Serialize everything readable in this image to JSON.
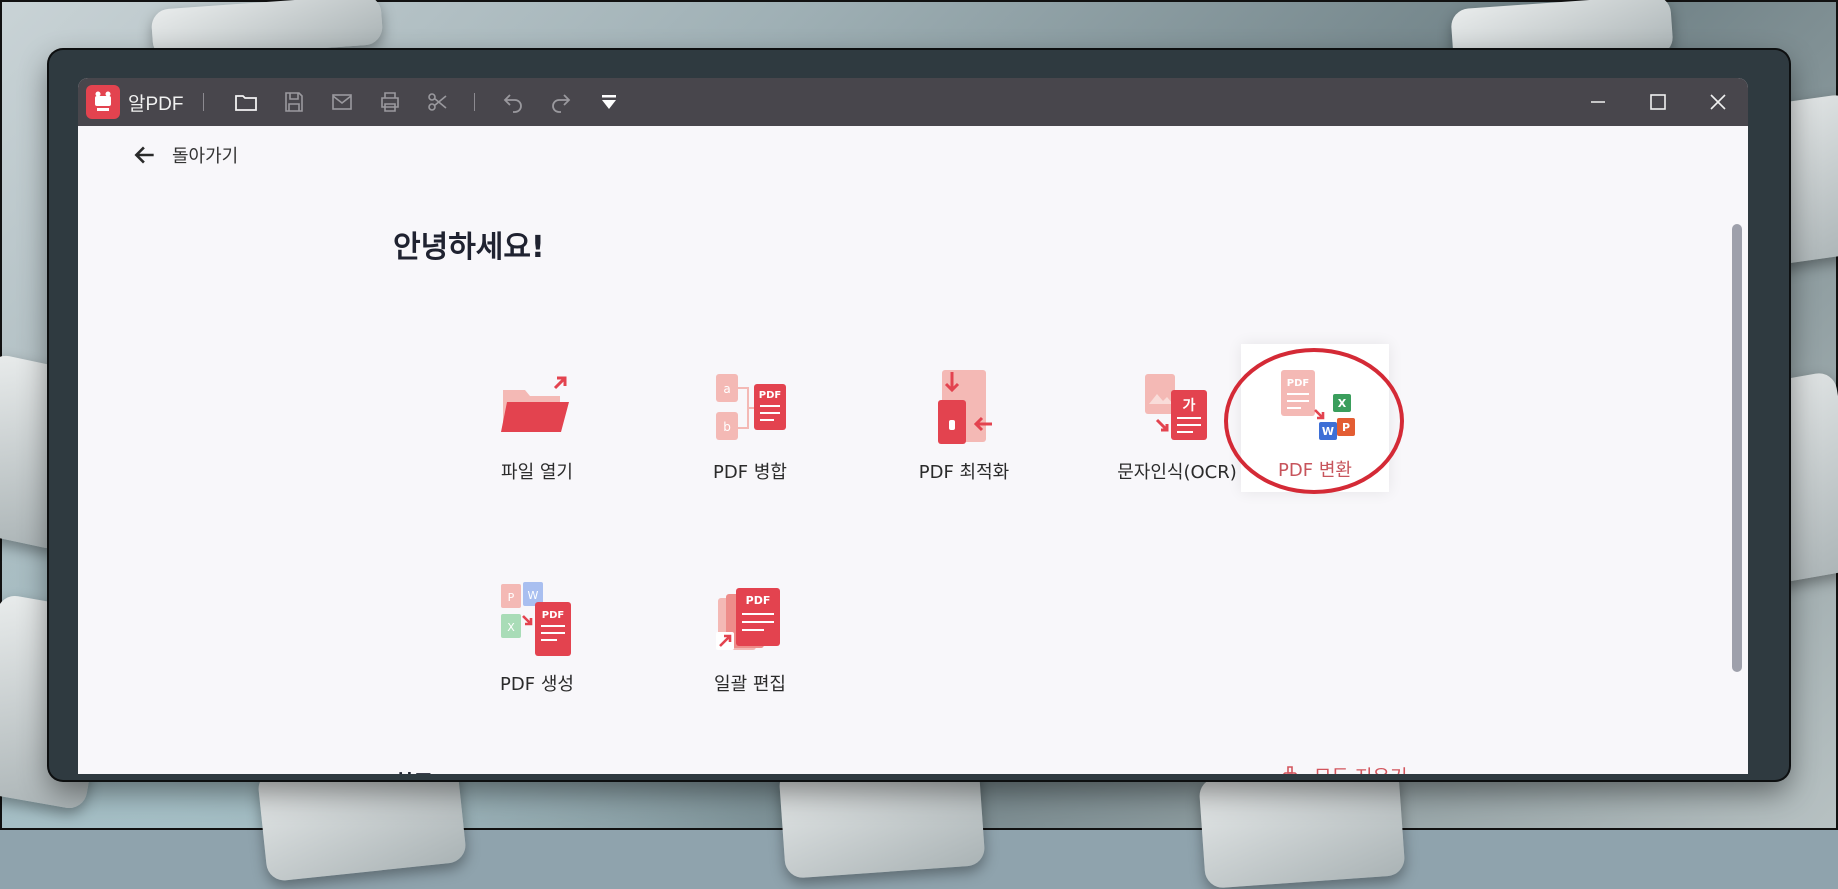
{
  "window": {
    "app_name": "알PDF",
    "toolbar": [
      "folder-icon",
      "save-icon",
      "mail-icon",
      "print-icon",
      "scissors-icon",
      "undo-icon",
      "redo-icon",
      "more-dropdown-icon"
    ]
  },
  "nav": {
    "back_label": "돌아가기"
  },
  "main": {
    "greeting": "안녕하세요!",
    "tiles": [
      {
        "label": "파일 열기"
      },
      {
        "label": "PDF 병합"
      },
      {
        "label": "PDF 최적화"
      },
      {
        "label": "문자인식(OCR)"
      },
      {
        "label": "PDF 변환",
        "selected": true
      },
      {
        "label": "PDF 생성"
      },
      {
        "label": "일괄 편집"
      }
    ],
    "recent_title": "최근",
    "clear_all_label": "모두 지우기"
  },
  "colors": {
    "accent": "#e3434f",
    "titlebar": "#48464c",
    "highlight": "#d42a36"
  },
  "icons": {
    "pdf_badge": "PDF",
    "ocr_badge": "가",
    "ocr_letter": "가"
  }
}
